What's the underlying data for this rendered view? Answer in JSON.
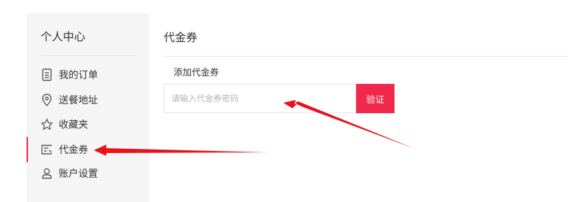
{
  "sidebar": {
    "title": "个人中心",
    "items": [
      {
        "label": "我的订单",
        "icon": "order-list-icon",
        "active": false
      },
      {
        "label": "送餐地址",
        "icon": "location-pin-icon",
        "active": false
      },
      {
        "label": "收藏夹",
        "icon": "star-icon",
        "active": false
      },
      {
        "label": "代金券",
        "icon": "voucher-icon",
        "active": true
      },
      {
        "label": "账户设置",
        "icon": "user-icon",
        "active": false
      }
    ]
  },
  "main": {
    "title": "代金券",
    "subtitle": "添加代金券",
    "input_placeholder": "请输入代金券密码",
    "verify_label": "验证"
  },
  "colors": {
    "accent": "#f0284a",
    "annotation_arrow": "#e8121b"
  }
}
